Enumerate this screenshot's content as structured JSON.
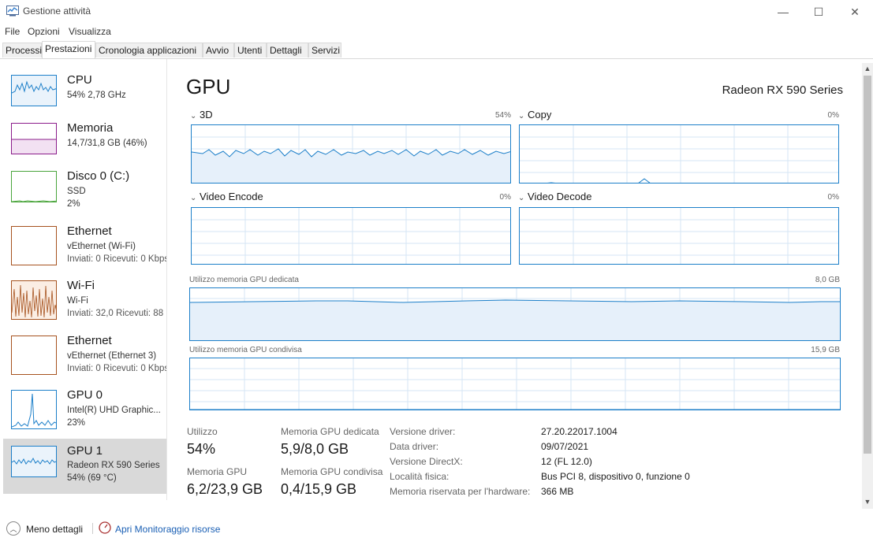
{
  "window": {
    "title": "Gestione attività",
    "minimize_glyph": "—",
    "maximize_glyph": "☐",
    "close_glyph": "✕"
  },
  "menu": [
    "File",
    "Opzioni",
    "Visualizza"
  ],
  "tabs": [
    "Processi",
    "Prestazioni",
    "Cronologia applicazioni",
    "Avvio",
    "Utenti",
    "Dettagli",
    "Servizi"
  ],
  "active_tab": "Prestazioni",
  "sidebar": [
    {
      "name": "CPU",
      "line1": "54%  2,78 GHz",
      "line2": "",
      "line3": "",
      "color": "#1c7fc9"
    },
    {
      "name": "Memoria",
      "line1": "14,7/31,8 GB (46%)",
      "line2": "",
      "line3": "",
      "color": "#8b1d8b"
    },
    {
      "name": "Disco 0 (C:)",
      "line1": "SSD",
      "line2": "2%",
      "line3": "",
      "color": "#4aa53c"
    },
    {
      "name": "Ethernet",
      "line1": "vEthernet (Wi-Fi)",
      "line2": "Inviati: 0  Ricevuti: 0 Kbps",
      "line3": "",
      "color": "#a6521e"
    },
    {
      "name": "Wi-Fi",
      "line1": "Wi-Fi",
      "line2": "Inviati: 32,0  Ricevuti: 88",
      "line3": "",
      "color": "#a6521e"
    },
    {
      "name": "Ethernet",
      "line1": "vEthernet (Ethernet 3)",
      "line2": "Inviati: 0  Ricevuti: 0 Kbps",
      "line3": "",
      "color": "#a6521e"
    },
    {
      "name": "GPU 0",
      "line1": "Intel(R) UHD Graphic...",
      "line2": "23%",
      "line3": "",
      "color": "#1c7fc9"
    },
    {
      "name": "GPU 1",
      "line1": "Radeon RX 590 Series",
      "line2": "54%  (69 °C)",
      "line3": "",
      "color": "#1c7fc9"
    }
  ],
  "main": {
    "title": "GPU",
    "model": "Radeon RX 590 Series",
    "graphs": [
      {
        "label": "3D",
        "pct": "54%"
      },
      {
        "label": "Copy",
        "pct": "0%"
      },
      {
        "label": "Video Encode",
        "pct": "0%"
      },
      {
        "label": "Video Decode",
        "pct": "0%"
      }
    ],
    "dedicated_label": "Utilizzo memoria GPU dedicata",
    "dedicated_max": "8,0 GB",
    "shared_label": "Utilizzo memoria GPU condivisa",
    "shared_max": "15,9 GB",
    "stats": {
      "utilizzo_label": "Utilizzo",
      "utilizzo_value": "54%",
      "dedicated_label": "Memoria GPU dedicata",
      "dedicated_value": "5,9/8,0 GB",
      "gpu_mem_label": "Memoria GPU",
      "gpu_mem_value": "6,2/23,9 GB",
      "shared_label": "Memoria GPU condivisa",
      "shared_value": "0,4/15,9 GB"
    },
    "info": [
      {
        "label": "Versione driver:",
        "value": "27.20.22017.1004"
      },
      {
        "label": "Data driver:",
        "value": "09/07/2021"
      },
      {
        "label": "Versione DirectX:",
        "value": "12 (FL 12.0)"
      },
      {
        "label": "Località fisica:",
        "value": "Bus PCI 8, dispositivo 0, funzione 0"
      },
      {
        "label": "Memoria riservata per l'hardware:",
        "value": "366 MB"
      }
    ]
  },
  "bottom": {
    "fewer_details": "Meno dettagli",
    "open_monitor": "Apri Monitoraggio risorse"
  },
  "colors": {
    "accent": "#1c7fc9",
    "graph_fill": "#e6f0fa",
    "grid": "#d6e6f4"
  }
}
